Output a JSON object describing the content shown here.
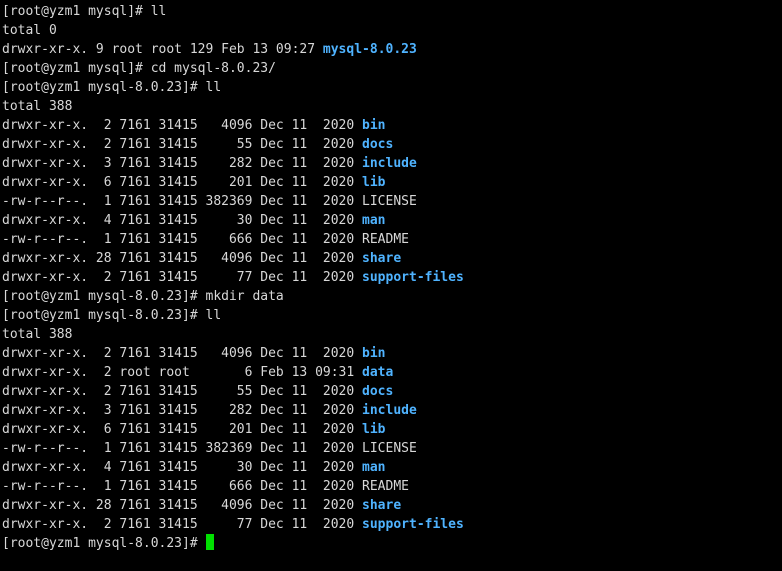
{
  "colors": {
    "background": "#000000",
    "text": "#d8d8d8",
    "directory": "#4fb3ff",
    "cursor": "#00e000"
  },
  "terminal": {
    "lines": [
      {
        "text": "[root@yzm1 mysql]# ll",
        "highlight": ""
      },
      {
        "text": "total 0",
        "highlight": ""
      },
      {
        "text": "drwxr-xr-x. 9 root root 129 Feb 13 09:27 ",
        "highlight": "mysql-8.0.23"
      },
      {
        "text": "[root@yzm1 mysql]# cd mysql-8.0.23/",
        "highlight": ""
      },
      {
        "text": "[root@yzm1 mysql-8.0.23]# ll",
        "highlight": ""
      },
      {
        "text": "total 388",
        "highlight": ""
      },
      {
        "text": "drwxr-xr-x.  2 7161 31415   4096 Dec 11  2020 ",
        "highlight": "bin"
      },
      {
        "text": "drwxr-xr-x.  2 7161 31415     55 Dec 11  2020 ",
        "highlight": "docs"
      },
      {
        "text": "drwxr-xr-x.  3 7161 31415    282 Dec 11  2020 ",
        "highlight": "include"
      },
      {
        "text": "drwxr-xr-x.  6 7161 31415    201 Dec 11  2020 ",
        "highlight": "lib"
      },
      {
        "text": "-rw-r--r--.  1 7161 31415 382369 Dec 11  2020 LICENSE",
        "highlight": ""
      },
      {
        "text": "drwxr-xr-x.  4 7161 31415     30 Dec 11  2020 ",
        "highlight": "man"
      },
      {
        "text": "-rw-r--r--.  1 7161 31415    666 Dec 11  2020 README",
        "highlight": ""
      },
      {
        "text": "drwxr-xr-x. 28 7161 31415   4096 Dec 11  2020 ",
        "highlight": "share"
      },
      {
        "text": "drwxr-xr-x.  2 7161 31415     77 Dec 11  2020 ",
        "highlight": "support-files"
      },
      {
        "text": "[root@yzm1 mysql-8.0.23]# mkdir data",
        "highlight": ""
      },
      {
        "text": "[root@yzm1 mysql-8.0.23]# ll",
        "highlight": ""
      },
      {
        "text": "total 388",
        "highlight": ""
      },
      {
        "text": "drwxr-xr-x.  2 7161 31415   4096 Dec 11  2020 ",
        "highlight": "bin"
      },
      {
        "text": "drwxr-xr-x.  2 root root       6 Feb 13 09:31 ",
        "highlight": "data"
      },
      {
        "text": "drwxr-xr-x.  2 7161 31415     55 Dec 11  2020 ",
        "highlight": "docs"
      },
      {
        "text": "drwxr-xr-x.  3 7161 31415    282 Dec 11  2020 ",
        "highlight": "include"
      },
      {
        "text": "drwxr-xr-x.  6 7161 31415    201 Dec 11  2020 ",
        "highlight": "lib"
      },
      {
        "text": "-rw-r--r--.  1 7161 31415 382369 Dec 11  2020 LICENSE",
        "highlight": ""
      },
      {
        "text": "drwxr-xr-x.  4 7161 31415     30 Dec 11  2020 ",
        "highlight": "man"
      },
      {
        "text": "-rw-r--r--.  1 7161 31415    666 Dec 11  2020 README",
        "highlight": ""
      },
      {
        "text": "drwxr-xr-x. 28 7161 31415   4096 Dec 11  2020 ",
        "highlight": "share"
      },
      {
        "text": "drwxr-xr-x.  2 7161 31415     77 Dec 11  2020 ",
        "highlight": "support-files"
      }
    ],
    "prompt": "[root@yzm1 mysql-8.0.23]# "
  }
}
